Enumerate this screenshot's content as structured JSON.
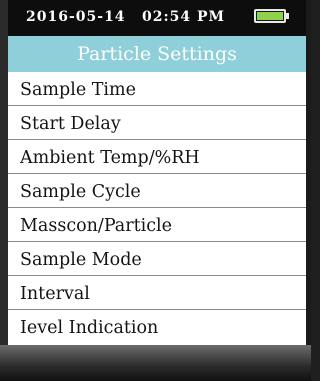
{
  "status": {
    "date": "2016-05-14",
    "time": "02:54 PM",
    "battery_level": 1.0,
    "battery_color": "#8fd14a"
  },
  "title": "Particle Settings",
  "title_color": "#8ecfd9",
  "menu": {
    "items": [
      {
        "label": "Sample Time"
      },
      {
        "label": "Start Delay"
      },
      {
        "label": "Ambient Temp/%RH"
      },
      {
        "label": "Sample Cycle"
      },
      {
        "label": "Masscon/Particle"
      },
      {
        "label": "Sample Mode"
      },
      {
        "label": "Interval"
      },
      {
        "label": "Ievel Indication"
      }
    ]
  }
}
